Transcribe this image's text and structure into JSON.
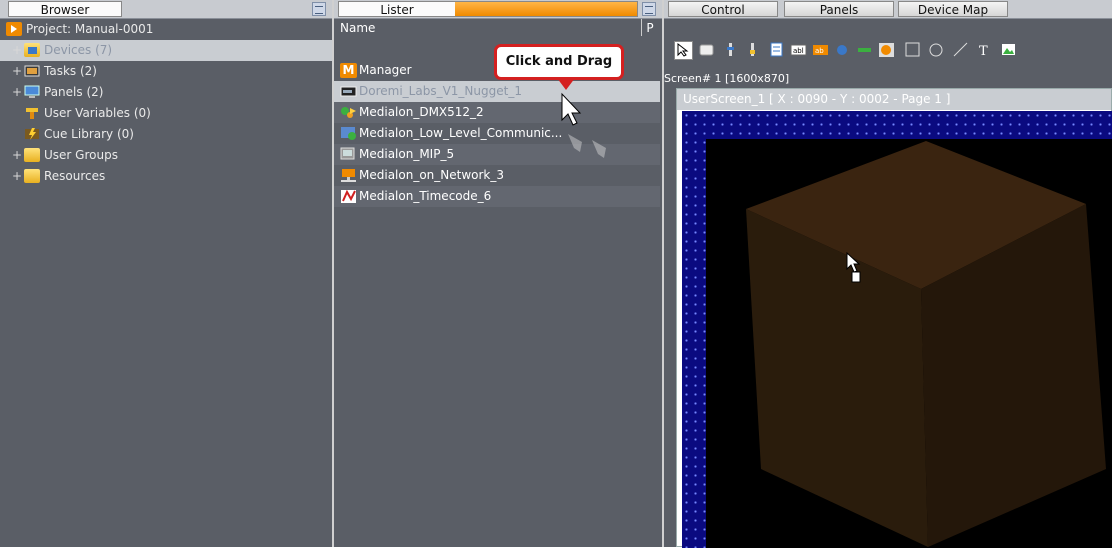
{
  "browser": {
    "tab_label": "Browser",
    "items": [
      {
        "expand": "",
        "label": "Project: Manual-0001"
      },
      {
        "expand": "+",
        "label": "Devices (7)"
      },
      {
        "expand": "+",
        "label": "Tasks (2)"
      },
      {
        "expand": "+",
        "label": "Panels (2)"
      },
      {
        "expand": "",
        "label": "User Variables (0)"
      },
      {
        "expand": "",
        "label": "Cue Library (0)"
      },
      {
        "expand": "+",
        "label": "User Groups"
      },
      {
        "expand": "+",
        "label": "Resources"
      }
    ]
  },
  "lister": {
    "tab_label": "Lister",
    "column_name": "Name",
    "column_p": "P",
    "items": [
      "Manager",
      "Doremi_Labs_V1_Nugget_1",
      "Medialon_DMX512_2",
      "Medialon_Low_Level_Communic...",
      "Medialon_MIP_5",
      "Medialon_on_Network_3",
      "Medialon_Timecode_6"
    ]
  },
  "callout": {
    "text": "Click and Drag"
  },
  "right": {
    "tabs": [
      "Control",
      "Panels",
      "Device Map"
    ],
    "screen_label": "Screen# 1 [1600x870]",
    "window_title": "UserScreen_1 [ X : 0090 - Y : 0002 - Page 1 ]"
  },
  "icons": [
    "arrow-tool-icon",
    "button-tool-icon",
    "slider-tool-icon",
    "fader-tool-icon",
    "list-tool-icon",
    "label-tool-icon",
    "text-tool-icon",
    "led-tool-icon",
    "meter-tool-icon",
    "knob-tool-icon",
    "rectangle-tool-icon",
    "ellipse-tool-icon",
    "line-tool-icon",
    "text-t-icon",
    "image-tool-icon"
  ],
  "colors": {
    "accent": "#f39a1a",
    "panel": "#5a5e66",
    "canvas": "#0a0a80",
    "cube": "#4a2e10",
    "callout_border": "#d42020"
  }
}
